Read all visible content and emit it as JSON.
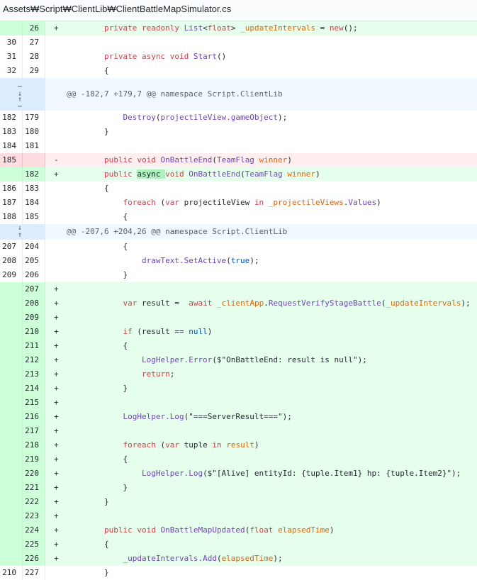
{
  "file_path": "Assets₩Script₩ClientLib₩ClientBattleMapSimulator.cs",
  "hunks": [
    "@@ -182,7 +179,7 @@ namespace Script.ClientLib",
    "@@ -207,6 +204,26 @@ namespace Script.ClientLib"
  ],
  "lines": [
    {
      "old": "",
      "new": "26",
      "m": "+",
      "t": "add",
      "seg": [
        [
          "",
          "        "
        ],
        [
          "kw",
          "private readonly "
        ],
        [
          "ty",
          "List"
        ],
        [
          "",
          "<"
        ],
        [
          "kw",
          "float"
        ],
        [
          "",
          "> "
        ],
        [
          "id",
          "_updateIntervals"
        ],
        [
          "",
          " = "
        ],
        [
          "kw",
          "new"
        ],
        [
          "",
          "();"
        ]
      ]
    },
    {
      "old": "30",
      "new": "27",
      "m": "",
      "t": "ctx",
      "seg": []
    },
    {
      "old": "31",
      "new": "28",
      "m": "",
      "t": "ctx",
      "seg": [
        [
          "",
          "        "
        ],
        [
          "kw",
          "private async void "
        ],
        [
          "fn",
          "Start"
        ],
        [
          "",
          "()"
        ]
      ]
    },
    {
      "old": "32",
      "new": "29",
      "m": "",
      "t": "ctx",
      "seg": [
        [
          "",
          "        {"
        ]
      ]
    },
    {
      "old": "182",
      "new": "179",
      "m": "",
      "t": "ctx",
      "seg": [
        [
          "",
          "            "
        ],
        [
          "fn",
          "Destroy"
        ],
        [
          "",
          "("
        ],
        [
          "fn",
          "projectileView.gameObject"
        ],
        [
          "",
          ");"
        ]
      ]
    },
    {
      "old": "183",
      "new": "180",
      "m": "",
      "t": "ctx",
      "seg": [
        [
          "",
          "        }"
        ]
      ]
    },
    {
      "old": "184",
      "new": "181",
      "m": "",
      "t": "ctx",
      "seg": []
    },
    {
      "old": "185",
      "new": "",
      "m": "-",
      "t": "del",
      "seg": [
        [
          "",
          "        "
        ],
        [
          "kw",
          "public void "
        ],
        [
          "fn",
          "OnBattleEnd"
        ],
        [
          "",
          "("
        ],
        [
          "ty",
          "TeamFlag"
        ],
        [
          "",
          " "
        ],
        [
          "id",
          "winner"
        ],
        [
          "",
          ")"
        ]
      ]
    },
    {
      "old": "",
      "new": "182",
      "m": "+",
      "t": "add",
      "seg": [
        [
          "",
          "        "
        ],
        [
          "kw",
          "public "
        ],
        [
          "hl",
          "async "
        ],
        [
          "kw",
          "void "
        ],
        [
          "fn",
          "OnBattleEnd"
        ],
        [
          "",
          "("
        ],
        [
          "ty",
          "TeamFlag"
        ],
        [
          "",
          " "
        ],
        [
          "id",
          "winner"
        ],
        [
          "",
          ")"
        ]
      ]
    },
    {
      "old": "186",
      "new": "183",
      "m": "",
      "t": "ctx",
      "seg": [
        [
          "",
          "        {"
        ]
      ]
    },
    {
      "old": "187",
      "new": "184",
      "m": "",
      "t": "ctx",
      "seg": [
        [
          "",
          "            "
        ],
        [
          "kw",
          "foreach"
        ],
        [
          "",
          " ("
        ],
        [
          "kw",
          "var"
        ],
        [
          "",
          " projectileView "
        ],
        [
          "kw",
          "in"
        ],
        [
          "",
          " "
        ],
        [
          "id",
          "_projectileViews"
        ],
        [
          "",
          "."
        ],
        [
          "fn",
          "Values"
        ],
        [
          "",
          ")"
        ]
      ]
    },
    {
      "old": "188",
      "new": "185",
      "m": "",
      "t": "ctx",
      "seg": [
        [
          "",
          "            {"
        ]
      ]
    },
    {
      "old": "207",
      "new": "204",
      "m": "",
      "t": "ctx",
      "seg": [
        [
          "",
          "            {"
        ]
      ]
    },
    {
      "old": "208",
      "new": "205",
      "m": "",
      "t": "ctx",
      "seg": [
        [
          "",
          "                "
        ],
        [
          "fn",
          "drawText.SetActive"
        ],
        [
          "",
          "("
        ],
        [
          "cn",
          "true"
        ],
        [
          "",
          ");"
        ]
      ]
    },
    {
      "old": "209",
      "new": "206",
      "m": "",
      "t": "ctx",
      "seg": [
        [
          "",
          "            }"
        ]
      ]
    },
    {
      "old": "",
      "new": "207",
      "m": "+",
      "t": "add",
      "seg": []
    },
    {
      "old": "",
      "new": "208",
      "m": "+",
      "t": "add",
      "seg": [
        [
          "",
          "            "
        ],
        [
          "kw",
          "var"
        ],
        [
          "",
          " result =  "
        ],
        [
          "kw",
          "await"
        ],
        [
          "",
          " "
        ],
        [
          "id",
          "_clientApp"
        ],
        [
          "",
          "."
        ],
        [
          "fn",
          "RequestVerifyStageBattle"
        ],
        [
          "",
          "("
        ],
        [
          "id",
          "_updateIntervals"
        ],
        [
          "",
          ");"
        ]
      ]
    },
    {
      "old": "",
      "new": "209",
      "m": "+",
      "t": "add",
      "seg": []
    },
    {
      "old": "",
      "new": "210",
      "m": "+",
      "t": "add",
      "seg": [
        [
          "",
          "            "
        ],
        [
          "kw",
          "if"
        ],
        [
          "",
          " (result == "
        ],
        [
          "cn",
          "null"
        ],
        [
          "",
          ")"
        ]
      ]
    },
    {
      "old": "",
      "new": "211",
      "m": "+",
      "t": "add",
      "seg": [
        [
          "",
          "            {"
        ]
      ]
    },
    {
      "old": "",
      "new": "212",
      "m": "+",
      "t": "add",
      "seg": [
        [
          "",
          "                "
        ],
        [
          "fn",
          "LogHelper.Error"
        ],
        [
          "",
          "($\"OnBattleEnd: result is null\");"
        ]
      ]
    },
    {
      "old": "",
      "new": "213",
      "m": "+",
      "t": "add",
      "seg": [
        [
          "",
          "                "
        ],
        [
          "kw",
          "return"
        ],
        [
          "",
          ";"
        ]
      ]
    },
    {
      "old": "",
      "new": "214",
      "m": "+",
      "t": "add",
      "seg": [
        [
          "",
          "            }"
        ]
      ]
    },
    {
      "old": "",
      "new": "215",
      "m": "+",
      "t": "add",
      "seg": []
    },
    {
      "old": "",
      "new": "216",
      "m": "+",
      "t": "add",
      "seg": [
        [
          "",
          "            "
        ],
        [
          "fn",
          "LogHelper.Log"
        ],
        [
          "",
          "(\"===ServerResult===\");"
        ]
      ]
    },
    {
      "old": "",
      "new": "217",
      "m": "+",
      "t": "add",
      "seg": []
    },
    {
      "old": "",
      "new": "218",
      "m": "+",
      "t": "add",
      "seg": [
        [
          "",
          "            "
        ],
        [
          "kw",
          "foreach"
        ],
        [
          "",
          " ("
        ],
        [
          "kw",
          "var"
        ],
        [
          "",
          " tuple "
        ],
        [
          "kw",
          "in"
        ],
        [
          "",
          " "
        ],
        [
          "id",
          "result"
        ],
        [
          "",
          ")"
        ]
      ]
    },
    {
      "old": "",
      "new": "219",
      "m": "+",
      "t": "add",
      "seg": [
        [
          "",
          "            {"
        ]
      ]
    },
    {
      "old": "",
      "new": "220",
      "m": "+",
      "t": "add",
      "seg": [
        [
          "",
          "                "
        ],
        [
          "fn",
          "LogHelper.Log"
        ],
        [
          "",
          "($\"[Alive] entityId: {tuple.Item1} hp: {tuple.Item2}\");"
        ]
      ]
    },
    {
      "old": "",
      "new": "221",
      "m": "+",
      "t": "add",
      "seg": [
        [
          "",
          "            }"
        ]
      ]
    },
    {
      "old": "",
      "new": "222",
      "m": "+",
      "t": "add",
      "seg": [
        [
          "",
          "        }"
        ]
      ]
    },
    {
      "old": "",
      "new": "223",
      "m": "+",
      "t": "add",
      "seg": []
    },
    {
      "old": "",
      "new": "224",
      "m": "+",
      "t": "add",
      "seg": [
        [
          "",
          "        "
        ],
        [
          "kw",
          "public void "
        ],
        [
          "fn",
          "OnBattleMapUpdated"
        ],
        [
          "",
          "("
        ],
        [
          "kw",
          "float"
        ],
        [
          "",
          " "
        ],
        [
          "id",
          "elapsedTime"
        ],
        [
          "",
          ")"
        ]
      ]
    },
    {
      "old": "",
      "new": "225",
      "m": "+",
      "t": "add",
      "seg": [
        [
          "",
          "        {"
        ]
      ]
    },
    {
      "old": "",
      "new": "226",
      "m": "+",
      "t": "add",
      "seg": [
        [
          "",
          "            "
        ],
        [
          "fn",
          "_updateIntervals.Add"
        ],
        [
          "",
          "("
        ],
        [
          "id",
          "elapsedTime"
        ],
        [
          "",
          ");"
        ]
      ]
    },
    {
      "old": "210",
      "new": "227",
      "m": "",
      "t": "ctx",
      "seg": [
        [
          "",
          "        }"
        ]
      ]
    }
  ],
  "icons": {
    "expand_up": "arrow-up-icon",
    "expand_down": "arrow-down-icon",
    "expand_both": "unfold-icon"
  }
}
